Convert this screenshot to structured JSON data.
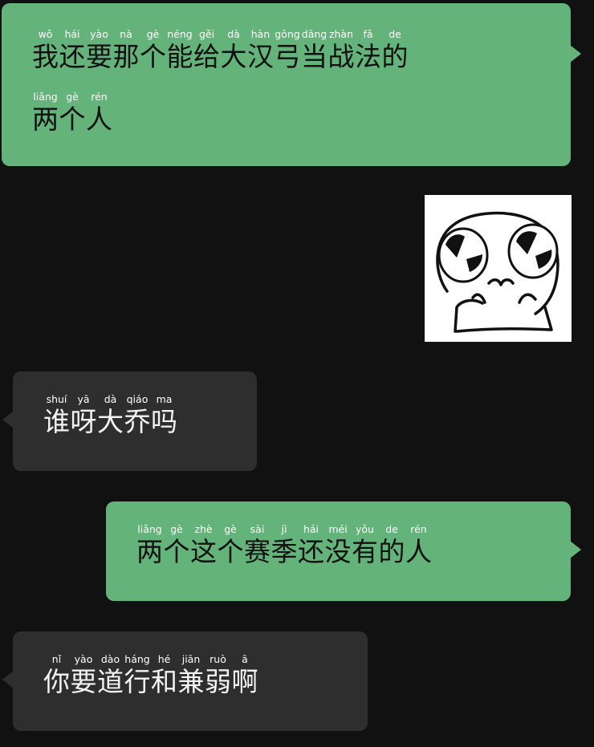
{
  "messages": [
    {
      "id": "m1",
      "direction": "sent",
      "lines": [
        [
          {
            "py": "wǒ",
            "hz": "我"
          },
          {
            "py": "hái",
            "hz": "还"
          },
          {
            "py": "yào",
            "hz": "要"
          },
          {
            "py": "nà",
            "hz": "那"
          },
          {
            "py": "gè",
            "hz": "个"
          },
          {
            "py": "néng",
            "hz": "能"
          },
          {
            "py": "gěi",
            "hz": "给"
          },
          {
            "py": "dà",
            "hz": "大"
          },
          {
            "py": "hàn",
            "hz": "汉"
          },
          {
            "py": "gōng",
            "hz": "弓"
          },
          {
            "py": "dāng",
            "hz": "当"
          },
          {
            "py": "zhàn",
            "hz": "战"
          },
          {
            "py": "fǎ",
            "hz": "法"
          },
          {
            "py": "de",
            "hz": "的"
          }
        ],
        [
          {
            "py": "liǎng",
            "hz": "两"
          },
          {
            "py": "gè",
            "hz": "个"
          },
          {
            "py": "rén",
            "hz": "人"
          }
        ]
      ]
    },
    {
      "id": "m2",
      "direction": "sent",
      "sticker": "crying-face-meme-sticker"
    },
    {
      "id": "m3",
      "direction": "received",
      "lines": [
        [
          {
            "py": "shuí",
            "hz": "谁"
          },
          {
            "py": "yā",
            "hz": "呀"
          },
          {
            "py": "dà",
            "hz": "大"
          },
          {
            "py": "qiáo",
            "hz": "乔"
          },
          {
            "py": "ma",
            "hz": "吗"
          }
        ]
      ]
    },
    {
      "id": "m4",
      "direction": "sent",
      "lines": [
        [
          {
            "py": "liǎng",
            "hz": "两"
          },
          {
            "py": "gè",
            "hz": "个"
          },
          {
            "py": "zhè",
            "hz": "这"
          },
          {
            "py": "gè",
            "hz": "个"
          },
          {
            "py": "sài",
            "hz": "赛"
          },
          {
            "py": "jì",
            "hz": "季"
          },
          {
            "py": "hái",
            "hz": "还"
          },
          {
            "py": "méi",
            "hz": "没"
          },
          {
            "py": "yǒu",
            "hz": "有"
          },
          {
            "py": "de",
            "hz": "的"
          },
          {
            "py": "rén",
            "hz": "人"
          }
        ]
      ]
    },
    {
      "id": "m5",
      "direction": "received",
      "lines": [
        [
          {
            "py": "nǐ",
            "hz": "你"
          },
          {
            "py": "yào",
            "hz": "要"
          },
          {
            "py": "dào",
            "hz": "道"
          },
          {
            "py": "háng",
            "hz": "行"
          },
          {
            "py": "hé",
            "hz": "和"
          },
          {
            "py": "jiān",
            "hz": "兼"
          },
          {
            "py": "ruò",
            "hz": "弱"
          },
          {
            "py": "ā",
            "hz": "啊"
          }
        ]
      ]
    }
  ],
  "colors": {
    "background": "#111111",
    "sent_bubble": "#64b37a",
    "received_bubble": "#2e2e2e"
  }
}
